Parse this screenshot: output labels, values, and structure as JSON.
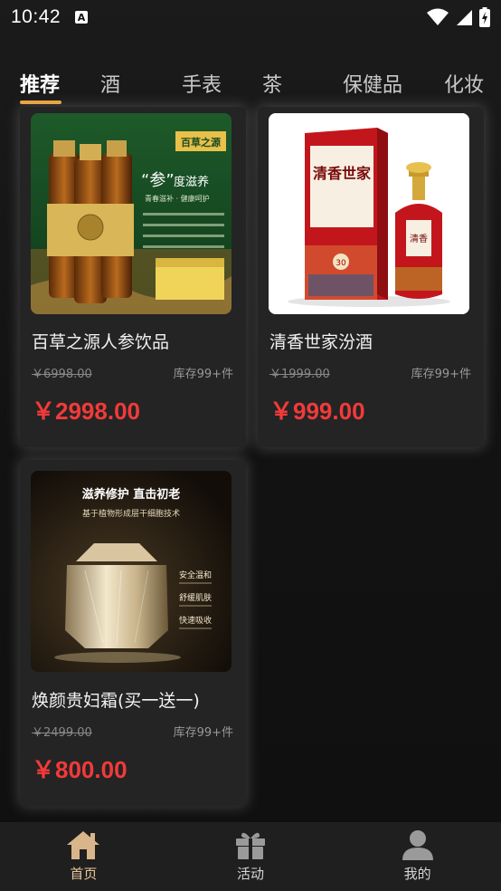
{
  "status": {
    "time": "10:42",
    "a_icon": "A"
  },
  "tabs": [
    {
      "label": "推荐",
      "active": true
    },
    {
      "label": "酒"
    },
    {
      "label": "手表"
    },
    {
      "label": "茶"
    },
    {
      "label": "保健品"
    },
    {
      "label": "化妆"
    }
  ],
  "products": [
    {
      "title": "百草之源人参饮品",
      "original_price": "￥6998.00",
      "stock": "库存99+件",
      "price": "￥2998.00",
      "image": {
        "brand": "百草之源",
        "headline_1": "“参”",
        "headline_2": "度滋养",
        "sub": "青春滋补 · 健康呵护"
      }
    },
    {
      "title": "清香世家汾酒",
      "original_price": "￥1999.00",
      "stock": "库存99+件",
      "price": "￥999.00",
      "image": {
        "box_text": "清香世家",
        "badge": "30"
      }
    },
    {
      "title": "焕颜贵妇霜(买一送一)",
      "original_price": "￥2499.00",
      "stock": "库存99+件",
      "price": "￥800.00",
      "image": {
        "headline": "滋养修护 直击初老",
        "sub": "基于植物形成层干细胞技术",
        "tags": [
          "安全温和",
          "舒缓肌肤",
          "快速吸收"
        ]
      }
    }
  ],
  "bottom_nav": [
    {
      "label": "首页",
      "icon": "home-icon",
      "active": true
    },
    {
      "label": "活动",
      "icon": "gift-icon"
    },
    {
      "label": "我的",
      "icon": "user-icon"
    }
  ],
  "colors": {
    "accent": "#f0a53a",
    "price": "#f23a3a",
    "nav_active": "#e8c79a"
  }
}
